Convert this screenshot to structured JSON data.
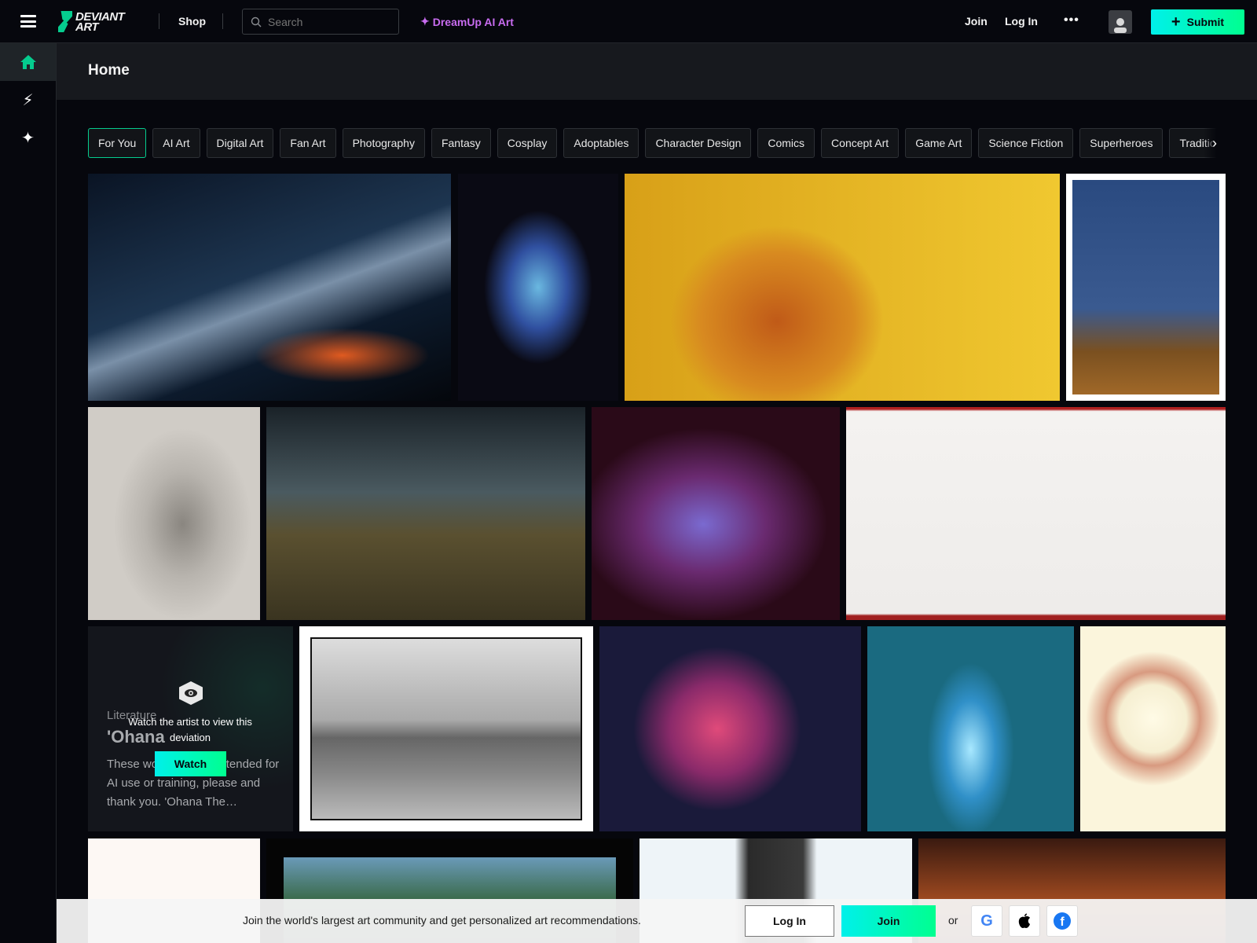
{
  "header": {
    "logo_text_1": "DEVIANT",
    "logo_text_2": "ART",
    "shop": "Shop",
    "search_placeholder": "Search",
    "dreamup": "DreamUp AI Art",
    "join": "Join",
    "login": "Log In",
    "more": "•••",
    "submit": "Submit"
  },
  "sidebar": {
    "items": [
      {
        "icon": "home-icon",
        "active": true
      },
      {
        "icon": "lightning-icon"
      },
      {
        "icon": "dreamup-icon"
      }
    ]
  },
  "page": {
    "title": "Home"
  },
  "tabs": [
    "For You",
    "AI Art",
    "Digital Art",
    "Fan Art",
    "Photography",
    "Fantasy",
    "Cosplay",
    "Adoptables",
    "Character Design",
    "Comics",
    "Concept Art",
    "Game Art",
    "Science Fiction",
    "Superheroes",
    "Traditional"
  ],
  "literature_card": {
    "category": "Literature",
    "title": "'Ohana",
    "excerpt": "These works are not intended for AI use or training, please and thank you. 'Ohana The…",
    "overlay_text": "Watch the artist to view this deviation",
    "watch_button": "Watch"
  },
  "banner": {
    "text": "Join the world's largest art community and get personalized art recommendations.",
    "login": "Log In",
    "join": "Join",
    "or": "or"
  },
  "colors": {
    "accent": "#05cc8e",
    "dreamup": "#c86cf0",
    "submit_gradient": [
      "#00f0ea",
      "#00ff90"
    ]
  }
}
